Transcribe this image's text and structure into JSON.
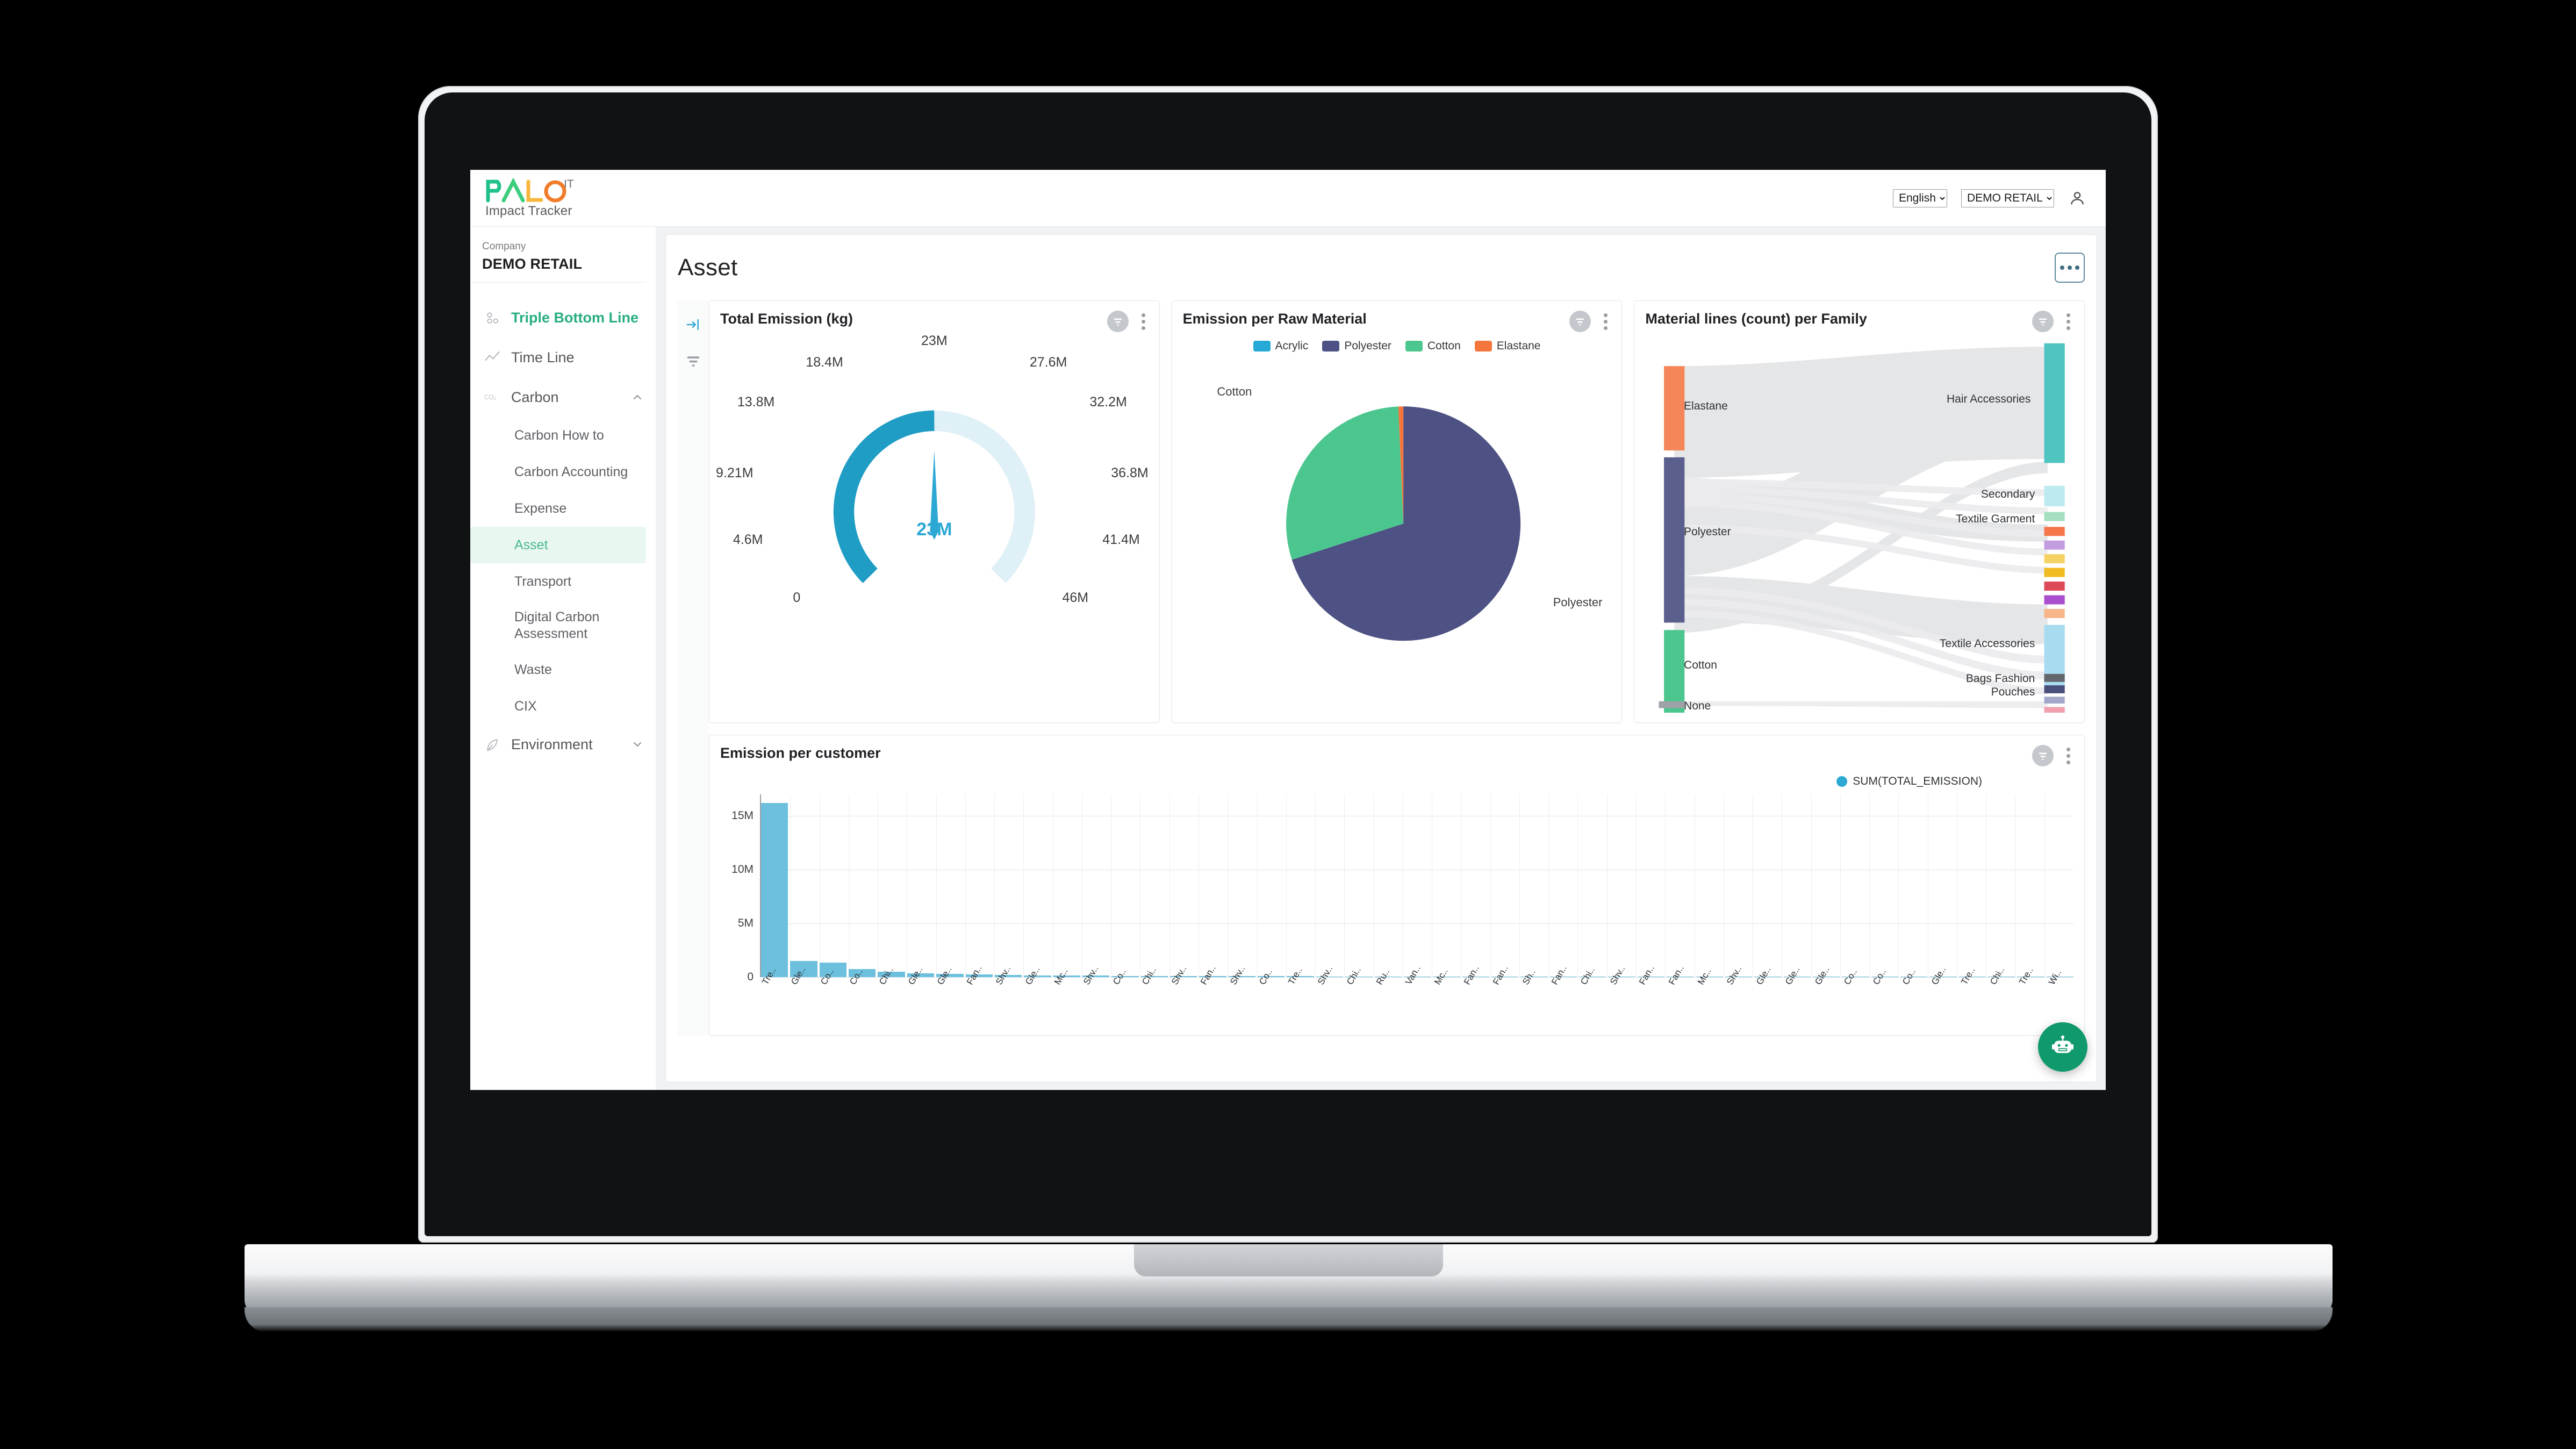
{
  "app": {
    "logo_text_1": "PAL",
    "logo_text_2": "O",
    "logo_text_3": "IT",
    "subtitle": "Impact Tracker",
    "language_selected": "English",
    "language_options": [
      "English"
    ],
    "tenant_selected": "DEMO RETAIL",
    "tenant_options": [
      "DEMO RETAIL"
    ],
    "user_icon": "user-account-icon"
  },
  "sidebar": {
    "company_label": "Company",
    "company_value": "DEMO RETAIL",
    "items": [
      {
        "label": "Triple Bottom Line",
        "icon": "scatter-dots-icon",
        "active": true,
        "expandable": false
      },
      {
        "label": "Time Line",
        "icon": "line-chart-icon",
        "active": false,
        "expandable": false
      },
      {
        "label": "Carbon",
        "icon": "co2-icon",
        "active": false,
        "expandable": true,
        "expanded": true
      }
    ],
    "carbon_subitems": [
      {
        "label": "Carbon How to",
        "active": false
      },
      {
        "label": "Carbon Accounting",
        "active": false
      },
      {
        "label": "Expense",
        "active": false
      },
      {
        "label": "Asset",
        "active": true
      },
      {
        "label": "Transport",
        "active": false
      },
      {
        "label": "Digital Carbon Assessment",
        "active": false,
        "two_line": true
      },
      {
        "label": "Waste",
        "active": false
      },
      {
        "label": "CIX",
        "active": false
      }
    ],
    "bottom_items": [
      {
        "label": "Environment",
        "icon": "environment-icon",
        "expandable": true,
        "expanded": false
      }
    ]
  },
  "page": {
    "title": "Asset",
    "more_button_label": "...",
    "rail_icons": [
      "expand-panel-icon",
      "filter-icon"
    ]
  },
  "chart_data": [
    {
      "type": "gauge",
      "title": "Total Emission (kg)",
      "value": 23000000,
      "value_label": "23M",
      "min": 0,
      "max": 46000000,
      "tick_labels": [
        "0",
        "4.6M",
        "9.21M",
        "13.8M",
        "18.4M",
        "23M",
        "27.6M",
        "32.2M",
        "36.8M",
        "41.4M",
        "46M"
      ],
      "tick_values": [
        0,
        4600000,
        9210000,
        13800000,
        18400000,
        23000000,
        27600000,
        32200000,
        36800000,
        41400000,
        46000000
      ],
      "arc_color": "#1f9dc4",
      "track_color": "#dff0f7",
      "needle_color": "#2ca8d4",
      "card_actions": {
        "filter": "filter-icon",
        "menu": "kebab-menu-icon"
      }
    },
    {
      "type": "pie",
      "title": "Emission per Raw Material",
      "legend_position": "top",
      "labels": [
        "Acrylic",
        "Polyester",
        "Cotton",
        "Elastane"
      ],
      "values": [
        0.3,
        77.2,
        21.0,
        1.5
      ],
      "colors": [
        "#26a9d6",
        "#4d5183",
        "#4cc68f",
        "#f4763c"
      ],
      "annotations": [
        "Cotton",
        "Polyester"
      ],
      "card_actions": {
        "filter": "filter-icon",
        "menu": "kebab-menu-icon"
      }
    },
    {
      "type": "sankey",
      "title": "Material lines (count) per Family",
      "source_nodes": [
        {
          "label": "Elastane",
          "color": "#f4865a",
          "value": 14
        },
        {
          "label": "Polyester",
          "color": "#5b5f8e",
          "value": 34
        },
        {
          "label": "Cotton",
          "color": "#4cc68f",
          "value": 15
        },
        {
          "label": "None",
          "color": "#9ea2a6",
          "value": 1
        }
      ],
      "target_nodes": [
        {
          "label": "Hair Accessories",
          "color": "#4fc4c0",
          "value": 38
        },
        {
          "label": "Secondary",
          "color": "#bdeaf0",
          "value": 4
        },
        {
          "label": "Textile Garment",
          "color": "#a6dfc0",
          "value": 2
        },
        {
          "label": "",
          "color": "#f4764a",
          "value": 1.4
        },
        {
          "label": "",
          "color": "#c39de0",
          "value": 1.3
        },
        {
          "label": "",
          "color": "#f5d264",
          "value": 1.2
        },
        {
          "label": "",
          "color": "#f0bc20",
          "value": 1.2
        },
        {
          "label": "",
          "color": "#dd4a57",
          "value": 1.2
        },
        {
          "label": "",
          "color": "#ab4fcf",
          "value": 1.2
        },
        {
          "label": "",
          "color": "#f6b68a",
          "value": 1.1
        },
        {
          "label": "Textile Accessories",
          "color": "#a8dbf0",
          "value": 16
        },
        {
          "label": "Bags Fashion",
          "color": "#63666a",
          "value": 1.3
        },
        {
          "label": "Pouches",
          "color": "#4a4f7c",
          "value": 1.3
        },
        {
          "label": "",
          "color": "#a3a8cb",
          "value": 1.2
        },
        {
          "label": "",
          "color": "#f2a0ae",
          "value": 1.2
        }
      ],
      "card_actions": {
        "filter": "filter-icon",
        "menu": "kebab-menu-icon"
      }
    },
    {
      "type": "bar",
      "title": "Emission per customer",
      "legend": [
        "SUM(TOTAL_EMISSION)"
      ],
      "legend_color": "#2ca8d4",
      "bar_color": "#6cc0dd",
      "ylabel": "",
      "xlabel": "",
      "ylim": [
        0,
        17000000
      ],
      "ytick_labels": [
        "0",
        "5M",
        "10M",
        "15M"
      ],
      "ytick_values": [
        0,
        5000000,
        10000000,
        15000000
      ],
      "categories": [
        "Tre..",
        "Gle..",
        "Co..",
        "Co..",
        "Chi..",
        "Gle..",
        "Gle..",
        "Fan..",
        "Shv..",
        "Gle..",
        "Mc..",
        "Shv..",
        "Co..",
        "Chi..",
        "Shv..",
        "Fan..",
        "Shv..",
        "Co..",
        "Tre..",
        "Shv..",
        "Chi..",
        "Ru..",
        "Van..",
        "Mc..",
        "Fan..",
        "Fan..",
        "Sh..",
        "Fan..",
        "Chi..",
        "Shv..",
        "Fan..",
        "Fan..",
        "Mc..",
        "Shv..",
        "Gle..",
        "Gle..",
        "Gle..",
        "Co..",
        "Co..",
        "Co..",
        "Gle..",
        "Tre..",
        "Chi..",
        "Tre..",
        "Wi.."
      ],
      "values": [
        16200000,
        1500000,
        1350000,
        750000,
        520000,
        330000,
        290000,
        270000,
        190000,
        160000,
        140000,
        130000,
        120000,
        110000,
        100000,
        95000,
        90000,
        85000,
        80000,
        75000,
        70000,
        66000,
        62000,
        58000,
        55000,
        52000,
        49000,
        46000,
        44000,
        42000,
        40000,
        38000,
        36000,
        34000,
        32000,
        30000,
        28000,
        26000,
        25000,
        23000,
        22000,
        20000,
        19000,
        18000,
        17000
      ],
      "card_actions": {
        "filter": "filter-icon",
        "menu": "kebab-menu-icon"
      }
    }
  ],
  "chatbot": {
    "icon": "robot-chat-icon",
    "color": "#10996c"
  }
}
